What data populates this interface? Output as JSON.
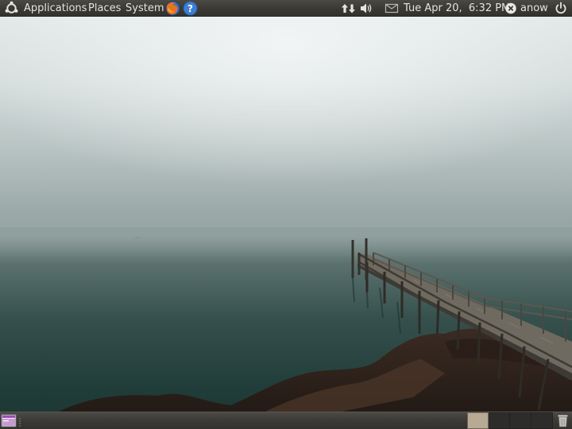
{
  "top_panel": {
    "menus": {
      "applications": "Applications",
      "places": "Places",
      "system": "System"
    },
    "clock": "Tue Apr 20,  6:32 PM",
    "user_name": "anow",
    "icons": {
      "main_menu": "ubuntu-logo",
      "browser_launcher": "firefox-icon",
      "help_launcher": "help-icon",
      "network": "network-updown-icon",
      "volume": "speaker-icon",
      "messaging": "envelope-icon",
      "presence": "offline-status-icon",
      "session": "power-icon"
    }
  },
  "bottom_panel": {
    "workspaces": [
      {
        "active": true
      },
      {
        "active": false
      },
      {
        "active": false
      },
      {
        "active": false
      }
    ],
    "icons": {
      "show_desktop": "show-desktop-icon",
      "trash": "trash-icon"
    }
  },
  "desktop": {
    "wallpaper": "misty lake with wooden pier"
  },
  "colors": {
    "panel": "#3c3b37",
    "panel_text": "#e6e4df",
    "active_workspace": "#b7a994",
    "fog_sky": "#dfe5e6",
    "water": "#1f3a36"
  }
}
